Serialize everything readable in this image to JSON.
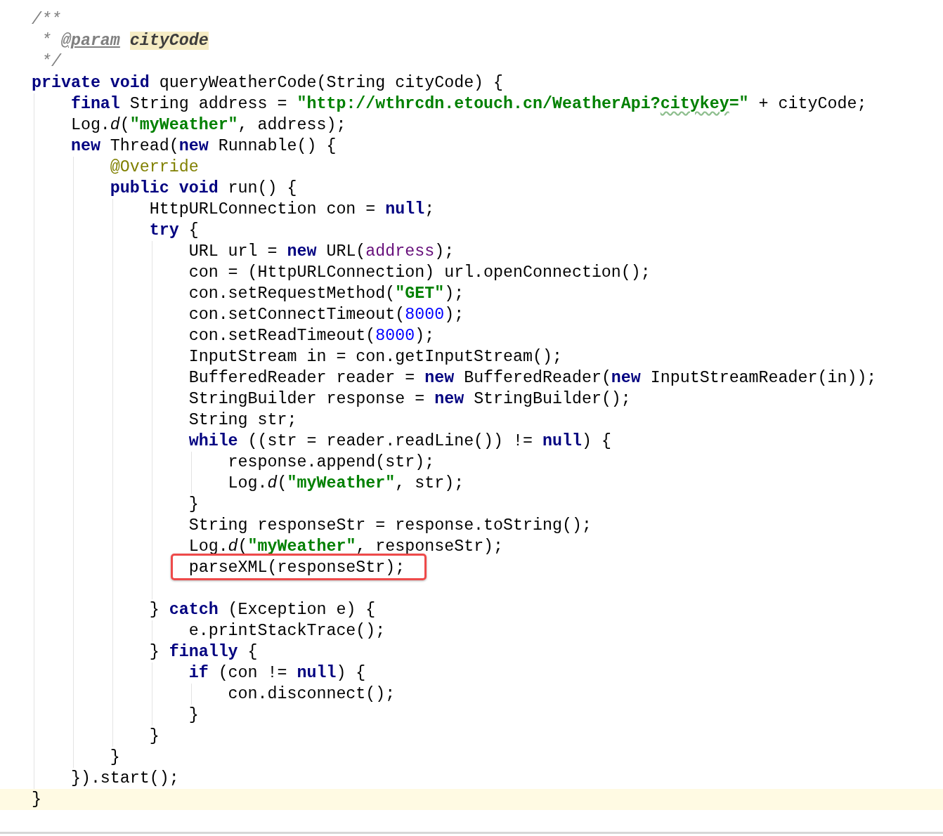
{
  "editor": {
    "lines": [
      {
        "tokens": [
          {
            "text": "/**",
            "kind": "comment"
          }
        ]
      },
      {
        "tokens": [
          {
            "text": " * ",
            "kind": "comment"
          },
          {
            "text": "@param",
            "kind": "doc_tag"
          },
          {
            "text": "cityCode",
            "kind": "doc_param"
          }
        ]
      },
      {
        "tokens": [
          {
            "text": " */",
            "kind": "comment"
          }
        ]
      },
      {
        "tokens": [
          {
            "text": "private void",
            "kind": "keyword"
          },
          {
            "text": " queryWeatherCode(String cityCode) {",
            "kind": "plain"
          }
        ]
      },
      {
        "tokens": [
          {
            "text": "    final",
            "kind": "keyword"
          },
          {
            "text": " String address = ",
            "kind": "plain"
          },
          {
            "text": "\"http://wthrcdn.etouch.cn/WeatherApi?",
            "kind": "string"
          },
          {
            "text": "citykey",
            "kind": "string_typo"
          },
          {
            "text": "=\"",
            "kind": "string"
          },
          {
            "text": " + cityCode;",
            "kind": "plain"
          }
        ]
      },
      {
        "tokens": [
          {
            "text": "    Log.",
            "kind": "plain"
          },
          {
            "text": "d",
            "kind": "static_method"
          },
          {
            "text": "(",
            "kind": "plain"
          },
          {
            "text": "\"myWeather\"",
            "kind": "string"
          },
          {
            "text": ", address);",
            "kind": "plain"
          }
        ]
      },
      {
        "tokens": [
          {
            "text": "    new",
            "kind": "keyword"
          },
          {
            "text": " Thread(",
            "kind": "plain"
          },
          {
            "text": "new",
            "kind": "keyword"
          },
          {
            "text": " Runnable() {",
            "kind": "plain"
          }
        ]
      },
      {
        "tokens": [
          {
            "text": "        @Override",
            "kind": "annotation"
          }
        ]
      },
      {
        "tokens": [
          {
            "text": "        public void",
            "kind": "keyword"
          },
          {
            "text": " run() {",
            "kind": "plain"
          }
        ]
      },
      {
        "tokens": [
          {
            "text": "            HttpURLConnection con = ",
            "kind": "plain"
          },
          {
            "text": "null",
            "kind": "keyword"
          },
          {
            "text": ";",
            "kind": "plain"
          }
        ]
      },
      {
        "tokens": [
          {
            "text": "            try",
            "kind": "keyword"
          },
          {
            "text": " {",
            "kind": "plain"
          }
        ]
      },
      {
        "tokens": [
          {
            "text": "                URL url = ",
            "kind": "plain"
          },
          {
            "text": "new",
            "kind": "keyword"
          },
          {
            "text": " URL(",
            "kind": "plain"
          },
          {
            "text": "address",
            "kind": "field"
          },
          {
            "text": ");",
            "kind": "plain"
          }
        ]
      },
      {
        "tokens": [
          {
            "text": "                con = (HttpURLConnection) url.openConnection();",
            "kind": "plain"
          }
        ]
      },
      {
        "tokens": [
          {
            "text": "                con.setRequestMethod(",
            "kind": "plain"
          },
          {
            "text": "\"GET\"",
            "kind": "string"
          },
          {
            "text": ");",
            "kind": "plain"
          }
        ]
      },
      {
        "tokens": [
          {
            "text": "                con.setConnectTimeout(",
            "kind": "plain"
          },
          {
            "text": "8000",
            "kind": "number"
          },
          {
            "text": ");",
            "kind": "plain"
          }
        ]
      },
      {
        "tokens": [
          {
            "text": "                con.setReadTimeout(",
            "kind": "plain"
          },
          {
            "text": "8000",
            "kind": "number"
          },
          {
            "text": ");",
            "kind": "plain"
          }
        ]
      },
      {
        "tokens": [
          {
            "text": "                InputStream in = con.getInputStream();",
            "kind": "plain"
          }
        ]
      },
      {
        "tokens": [
          {
            "text": "                BufferedReader reader = ",
            "kind": "plain"
          },
          {
            "text": "new",
            "kind": "keyword"
          },
          {
            "text": " BufferedReader(",
            "kind": "plain"
          },
          {
            "text": "new",
            "kind": "keyword"
          },
          {
            "text": " InputStreamReader(in));",
            "kind": "plain"
          }
        ]
      },
      {
        "tokens": [
          {
            "text": "                StringBuilder response = ",
            "kind": "plain"
          },
          {
            "text": "new",
            "kind": "keyword"
          },
          {
            "text": " StringBuilder();",
            "kind": "plain"
          }
        ]
      },
      {
        "tokens": [
          {
            "text": "                String str;",
            "kind": "plain"
          }
        ]
      },
      {
        "tokens": [
          {
            "text": "                while",
            "kind": "keyword"
          },
          {
            "text": " ((str = reader.readLine()) != ",
            "kind": "plain"
          },
          {
            "text": "null",
            "kind": "keyword"
          },
          {
            "text": ") {",
            "kind": "plain"
          }
        ]
      },
      {
        "tokens": [
          {
            "text": "                    response.append(str);",
            "kind": "plain"
          }
        ]
      },
      {
        "tokens": [
          {
            "text": "                    Log.",
            "kind": "plain"
          },
          {
            "text": "d",
            "kind": "static_method"
          },
          {
            "text": "(",
            "kind": "plain"
          },
          {
            "text": "\"myWeather\"",
            "kind": "string"
          },
          {
            "text": ", str);",
            "kind": "plain"
          }
        ]
      },
      {
        "tokens": [
          {
            "text": "                }",
            "kind": "plain"
          }
        ]
      },
      {
        "tokens": [
          {
            "text": "                String responseStr = response.toString();",
            "kind": "plain"
          }
        ]
      },
      {
        "tokens": [
          {
            "text": "                Log.",
            "kind": "plain"
          },
          {
            "text": "d",
            "kind": "static_method"
          },
          {
            "text": "(",
            "kind": "plain"
          },
          {
            "text": "\"myWeather\"",
            "kind": "string"
          },
          {
            "text": ", responseStr);",
            "kind": "plain"
          }
        ]
      },
      {
        "tokens": [
          {
            "text": "                parseXML(responseStr);",
            "kind": "plain"
          }
        ],
        "boxed": true
      },
      {
        "blank": true
      },
      {
        "tokens": [
          {
            "text": "            } ",
            "kind": "plain"
          },
          {
            "text": "catch",
            "kind": "keyword"
          },
          {
            "text": " (Exception e) {",
            "kind": "plain"
          }
        ]
      },
      {
        "tokens": [
          {
            "text": "                e.printStackTrace();",
            "kind": "plain"
          }
        ]
      },
      {
        "tokens": [
          {
            "text": "            } ",
            "kind": "plain"
          },
          {
            "text": "finally",
            "kind": "keyword"
          },
          {
            "text": " {",
            "kind": "plain"
          }
        ]
      },
      {
        "tokens": [
          {
            "text": "                if",
            "kind": "keyword"
          },
          {
            "text": " (con != ",
            "kind": "plain"
          },
          {
            "text": "null",
            "kind": "keyword"
          },
          {
            "text": ") {",
            "kind": "plain"
          }
        ]
      },
      {
        "tokens": [
          {
            "text": "                    con.disconnect();",
            "kind": "plain"
          }
        ]
      },
      {
        "tokens": [
          {
            "text": "                }",
            "kind": "plain"
          }
        ]
      },
      {
        "tokens": [
          {
            "text": "            }",
            "kind": "plain"
          }
        ]
      },
      {
        "tokens": [
          {
            "text": "        }",
            "kind": "plain"
          }
        ]
      },
      {
        "tokens": [
          {
            "text": "    }).start();",
            "kind": "plain"
          }
        ]
      },
      {
        "tokens": [
          {
            "text": "}",
            "kind": "plain"
          }
        ],
        "current": true
      }
    ]
  }
}
